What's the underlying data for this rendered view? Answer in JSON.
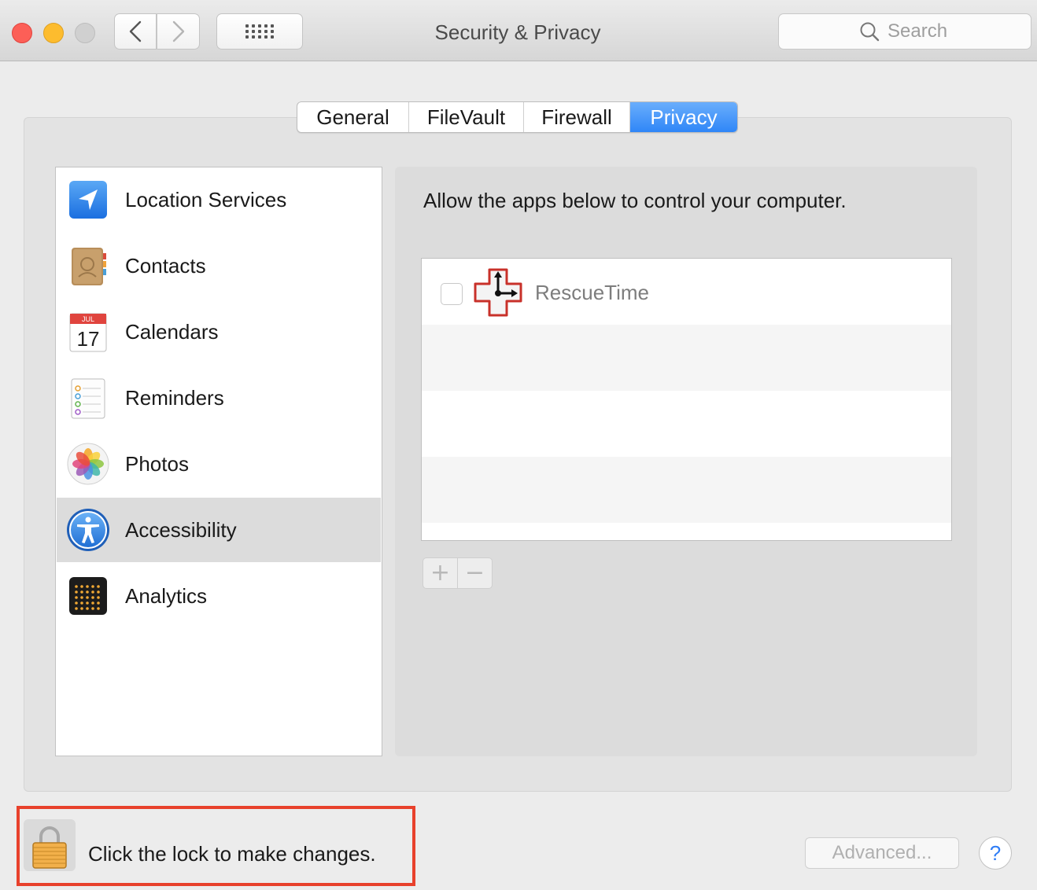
{
  "window": {
    "title": "Security & Privacy"
  },
  "search": {
    "placeholder": "Search"
  },
  "tabs": [
    {
      "label": "General",
      "active": false
    },
    {
      "label": "FileVault",
      "active": false
    },
    {
      "label": "Firewall",
      "active": false
    },
    {
      "label": "Privacy",
      "active": true
    }
  ],
  "sidebar": {
    "items": [
      {
        "label": "Location Services",
        "icon": "location-services-icon"
      },
      {
        "label": "Contacts",
        "icon": "contacts-icon"
      },
      {
        "label": "Calendars",
        "icon": "calendar-icon",
        "calendar_month": "JUL",
        "calendar_day": "17"
      },
      {
        "label": "Reminders",
        "icon": "reminders-icon"
      },
      {
        "label": "Photos",
        "icon": "photos-icon"
      },
      {
        "label": "Accessibility",
        "icon": "accessibility-icon",
        "selected": true
      },
      {
        "label": "Analytics",
        "icon": "analytics-icon"
      }
    ]
  },
  "main": {
    "heading": "Allow the apps below to control your computer.",
    "apps": [
      {
        "name": "RescueTime",
        "checked": false,
        "icon": "rescuetime-icon"
      }
    ],
    "add_symbol": "+",
    "remove_symbol": "−"
  },
  "footer": {
    "lock_text": "Click the lock to make changes.",
    "advanced_label": "Advanced...",
    "help_label": "?"
  },
  "colors": {
    "accent": "#2f86f7",
    "highlight": "#e8412c",
    "close": "#fc5f57",
    "minimize": "#fdbc2e"
  }
}
